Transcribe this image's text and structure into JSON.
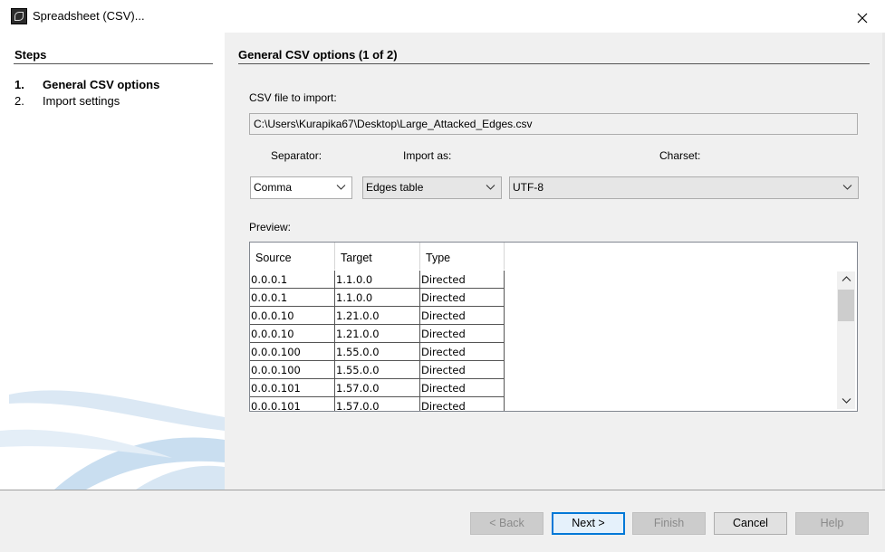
{
  "window": {
    "title": "Spreadsheet (CSV)...",
    "close_symbol": "✕",
    "app_icon": "gephi-app-icon",
    "close_icon": "close-icon"
  },
  "steps": {
    "title": "Steps",
    "items": [
      {
        "num": "1.",
        "label": "General CSV options",
        "active": true
      },
      {
        "num": "2.",
        "label": "Import settings",
        "active": false
      }
    ]
  },
  "main": {
    "title": "General CSV options (1 of 2)",
    "file_label": "CSV file to import:",
    "file_path": "C:\\Users\\Kurapika67\\Desktop\\Large_Attacked_Edges.csv",
    "separator_label": "Separator:",
    "import_as_label": "Import as:",
    "charset_label": "Charset:",
    "separator_value": "Comma",
    "import_as_value": "Edges table",
    "charset_value": "UTF-8",
    "preview_label": "Preview:",
    "preview": {
      "columns": [
        "Source",
        "Target",
        "Type"
      ],
      "rows": [
        [
          "0.0.0.1",
          "1.1.0.0",
          "Directed"
        ],
        [
          "0.0.0.1",
          "1.1.0.0",
          "Directed"
        ],
        [
          "0.0.0.10",
          "1.21.0.0",
          "Directed"
        ],
        [
          "0.0.0.10",
          "1.21.0.0",
          "Directed"
        ],
        [
          "0.0.0.100",
          "1.55.0.0",
          "Directed"
        ],
        [
          "0.0.0.100",
          "1.55.0.0",
          "Directed"
        ],
        [
          "0.0.0.101",
          "1.57.0.0",
          "Directed"
        ],
        [
          "0.0.0.101",
          "1.57.0.0",
          "Directed"
        ]
      ]
    }
  },
  "footer": {
    "back": "< Back",
    "next": "Next >",
    "finish": "Finish",
    "cancel": "Cancel",
    "help": "Help"
  },
  "colors": {
    "accent": "#0078d7",
    "panel_bg": "#f0f0f0",
    "swoosh": "#c9def0"
  }
}
